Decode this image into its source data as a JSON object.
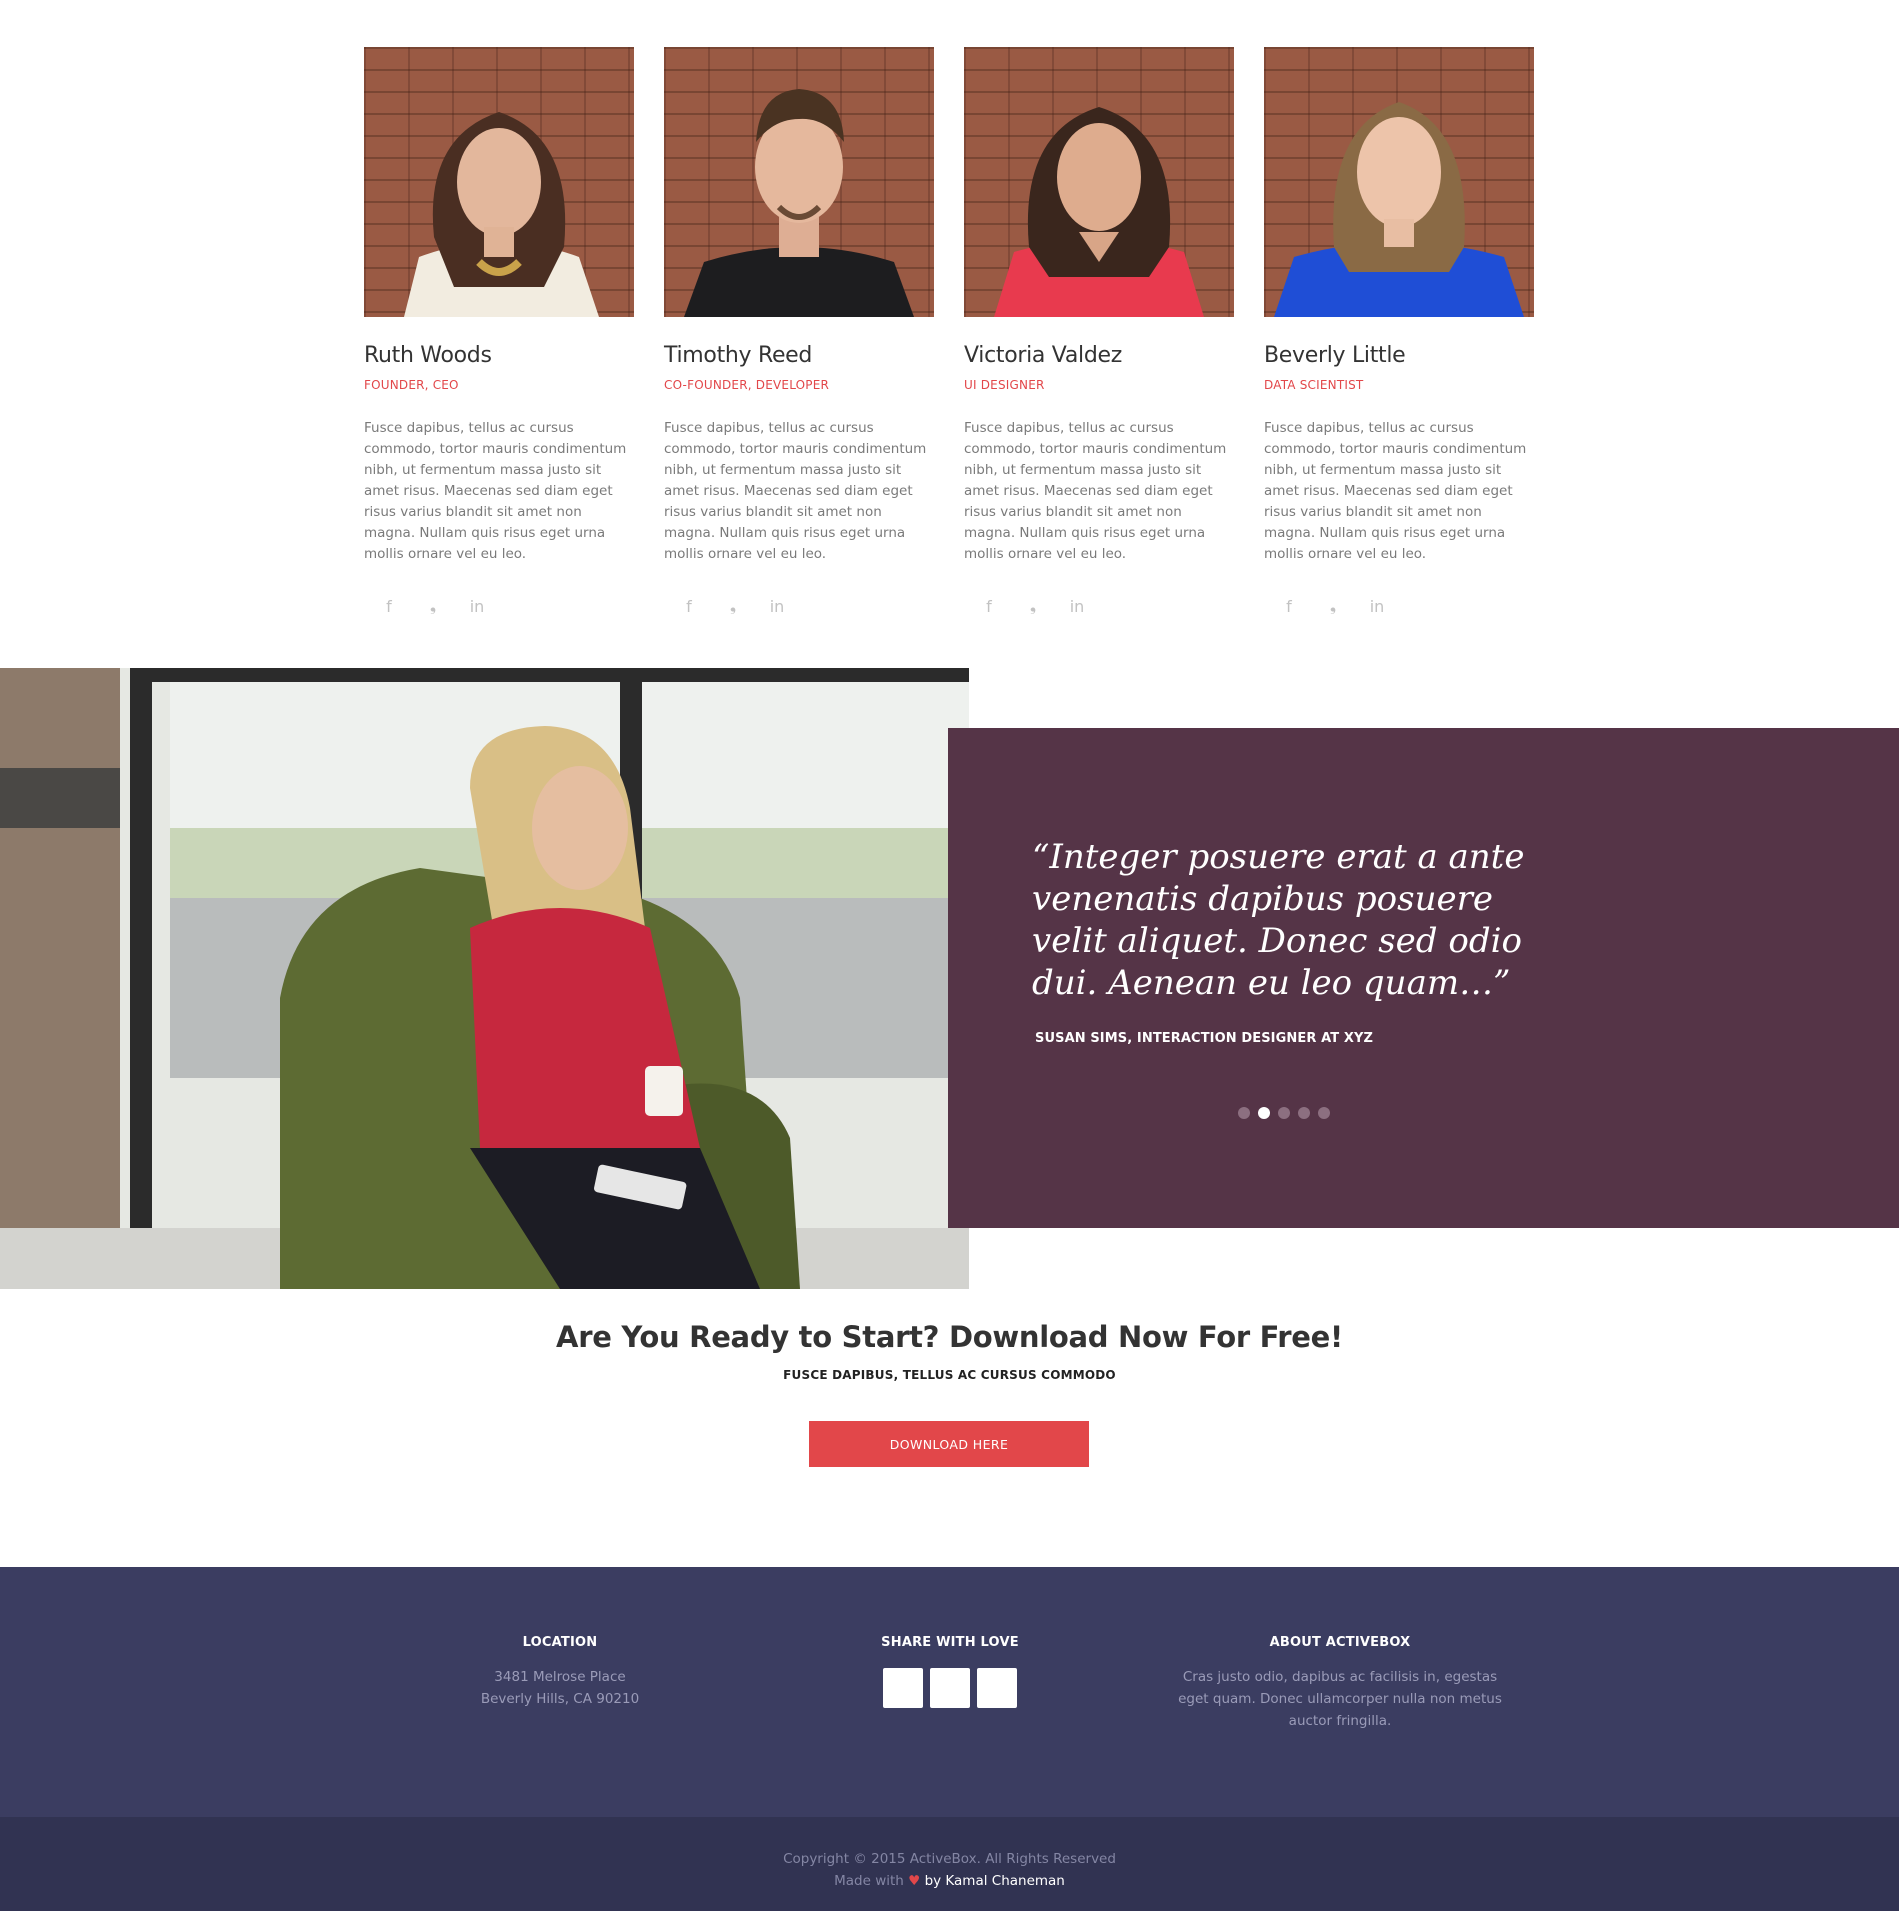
{
  "team": [
    {
      "name": "Ruth Woods",
      "role": "FOUNDER, CEO",
      "bio": "Fusce dapibus, tellus ac cursus commodo, tortor mauris condimentum nibh, ut fermentum massa justo sit amet risus. Maecenas sed diam eget risus varius blandit sit amet non magna. Nullam quis risus eget urna mollis ornare vel eu leo."
    },
    {
      "name": "Timothy Reed",
      "role": "CO-FOUNDER, DEVELOPER",
      "bio": "Fusce dapibus, tellus ac cursus commodo, tortor mauris condimentum nibh, ut fermentum massa justo sit amet risus. Maecenas sed diam eget risus varius blandit sit amet non magna. Nullam quis risus eget urna mollis ornare vel eu leo."
    },
    {
      "name": "Victoria Valdez",
      "role": "UI DESIGNER",
      "bio": "Fusce dapibus, tellus ac cursus commodo, tortor mauris condimentum nibh, ut fermentum massa justo sit amet risus. Maecenas sed diam eget risus varius blandit sit amet non magna. Nullam quis risus eget urna mollis ornare vel eu leo."
    },
    {
      "name": "Beverly Little",
      "role": "DATA SCIENTIST",
      "bio": "Fusce dapibus, tellus ac cursus commodo, tortor mauris condimentum nibh, ut fermentum massa justo sit amet risus. Maecenas sed diam eget risus varius blandit sit amet non magna. Nullam quis risus eget urna mollis ornare vel eu leo."
    }
  ],
  "social_icons": [
    "facebook-icon",
    "twitter-icon",
    "linkedin-icon"
  ],
  "social_glyphs": {
    "facebook": "f",
    "twitter": "❟",
    "linkedin": "in"
  },
  "testimonial": {
    "quote": "“Integer posuere erat a ante venenatis dapibus posuere velit aliquet. Donec sed odio dui. Aenean eu leo quam…”",
    "author": "SUSAN SIMS, INTERACTION DESIGNER AT XYZ",
    "slide_count": 5,
    "active_slide": 2
  },
  "cta": {
    "title": "Are You Ready to Start? Download Now For Free!",
    "subtitle": "FUSCE DAPIBUS, TELLUS AC CURSUS COMMODO",
    "button": "DOWNLOAD HERE"
  },
  "footer": {
    "location": {
      "heading": "LOCATION",
      "line1": "3481 Melrose Place",
      "line2": "Beverly Hills, CA 90210"
    },
    "share": {
      "heading": "SHARE WITH LOVE"
    },
    "about": {
      "heading": "ABOUT ACTIVEBOX",
      "text": "Cras justo odio, dapibus ac facilisis in, egestas eget quam. Donec ullamcorper nulla non metus auctor fringilla."
    },
    "copyright": "Copyright © 2015 ActiveBox. All Rights Reserved",
    "made_with": "Made with",
    "heart": "♥",
    "by": "by Kamal Chaneman"
  },
  "colors": {
    "accent": "#e2474a",
    "testimonial_bg": "#553447",
    "footer_bg": "#3b3d61",
    "footer_bottom_bg": "#313352"
  }
}
